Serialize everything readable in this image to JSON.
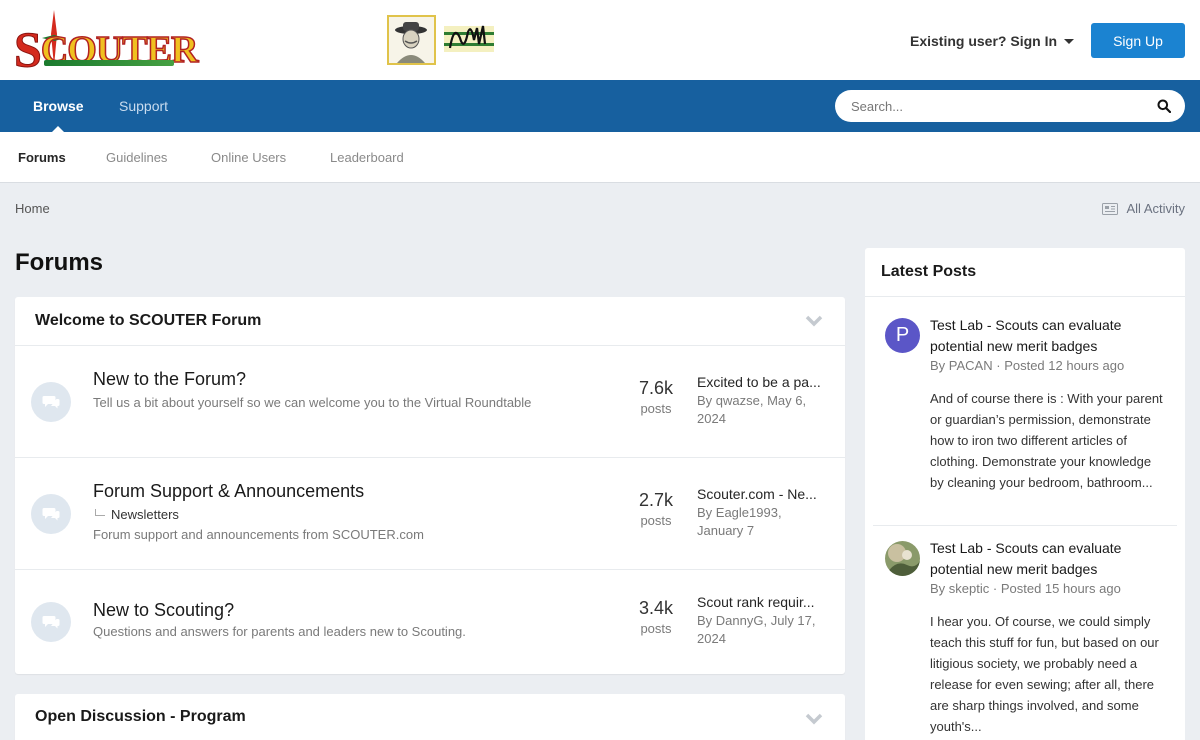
{
  "header": {
    "logo_text_s": "S",
    "logo_text_rest": "COUTER",
    "signin_label": "Existing user? Sign In",
    "signup_label": "Sign Up"
  },
  "nav": {
    "tabs": [
      {
        "label": "Browse"
      },
      {
        "label": "Support"
      }
    ],
    "search_placeholder": "Search..."
  },
  "subnav": {
    "items": [
      {
        "label": "Forums"
      },
      {
        "label": "Guidelines"
      },
      {
        "label": "Online Users"
      },
      {
        "label": "Leaderboard"
      }
    ]
  },
  "breadcrumb": {
    "home": "Home",
    "all_activity": "All Activity"
  },
  "page_title": "Forums",
  "sections": [
    {
      "title": "Welcome to SCOUTER Forum",
      "forums": [
        {
          "name": "New to the Forum?",
          "description": "Tell us a bit about yourself so we can welcome you to the Virtual Roundtable",
          "posts_count": "7.6k",
          "posts_label": "posts",
          "last_title": "Excited to be a pa...",
          "last_meta_line1": "By qwazse, May 6,",
          "last_meta_line2": "2024"
        },
        {
          "name": "Forum Support & Announcements",
          "subforum": "Newsletters",
          "description": "Forum support and announcements from SCOUTER.com",
          "posts_count": "2.7k",
          "posts_label": "posts",
          "last_title": "Scouter.com - Ne...",
          "last_meta_line1": "By Eagle1993,",
          "last_meta_line2": "January 7"
        },
        {
          "name": "New to Scouting?",
          "description": "Questions and answers for parents and leaders new to Scouting.",
          "posts_count": "3.4k",
          "posts_label": "posts",
          "last_title": "Scout rank requir...",
          "last_meta_line1": "By DannyG, July 17,",
          "last_meta_line2": "2024"
        }
      ]
    },
    {
      "title": "Open Discussion - Program"
    }
  ],
  "sidebar": {
    "title": "Latest Posts",
    "posts": [
      {
        "avatar_letter": "P",
        "avatar_color": "#5b56c7",
        "title": "Test Lab - Scouts can evaluate potential new merit badges",
        "by": "By",
        "author": "PACAN",
        "posted": "· Posted 12 hours ago",
        "body": "And of course there is : With your parent or guardian’s permission, demonstrate how to iron two different articles of clothing. Demonstrate your knowledge by cleaning your bedroom, bathroom..."
      },
      {
        "title": "Test Lab - Scouts can evaluate potential new merit badges",
        "by": "By",
        "author": "skeptic",
        "posted": "· Posted 15 hours ago",
        "body": "I hear you.  Of course, we could simply teach this stuff for fun, but based on our litigious society, we probably need a release for even sewing; after all, there are sharp things involved, and some youth's..."
      }
    ]
  },
  "colors": {
    "nav_bg": "#17609f",
    "signup_bg": "#1b83d1",
    "page_bg": "#ebeef2"
  }
}
